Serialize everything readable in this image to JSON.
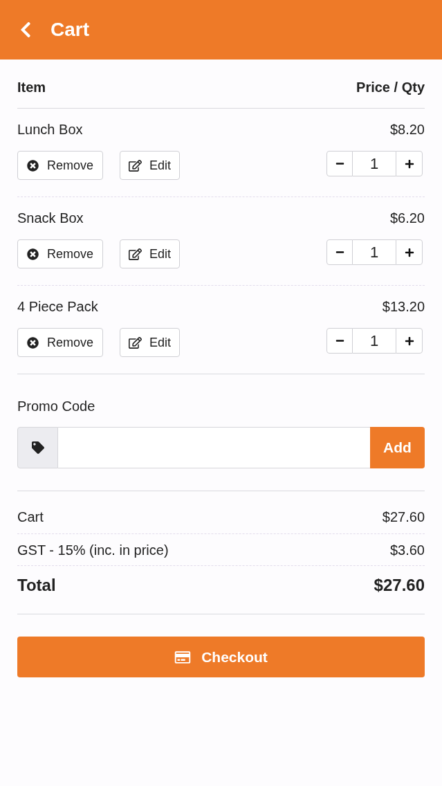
{
  "header": {
    "title": "Cart"
  },
  "columns": {
    "item": "Item",
    "price_qty": "Price / Qty"
  },
  "items": [
    {
      "name": "Lunch Box",
      "price": "$8.20",
      "remove_label": "Remove",
      "edit_label": "Edit",
      "qty": "1"
    },
    {
      "name": "Snack Box",
      "price": "$6.20",
      "remove_label": "Remove",
      "edit_label": "Edit",
      "qty": "1"
    },
    {
      "name": "4 Piece Pack",
      "price": "$13.20",
      "remove_label": "Remove",
      "edit_label": "Edit",
      "qty": "1"
    }
  ],
  "promo": {
    "label": "Promo Code",
    "button": "Add"
  },
  "summary": [
    {
      "kind": "line",
      "label": "Cart",
      "value": "$27.60"
    },
    {
      "kind": "line",
      "label": "GST - 15% (inc. in price)",
      "value": "$3.60"
    },
    {
      "kind": "total",
      "label": "Total",
      "value": "$27.60"
    }
  ],
  "checkout": {
    "label": "Checkout"
  }
}
